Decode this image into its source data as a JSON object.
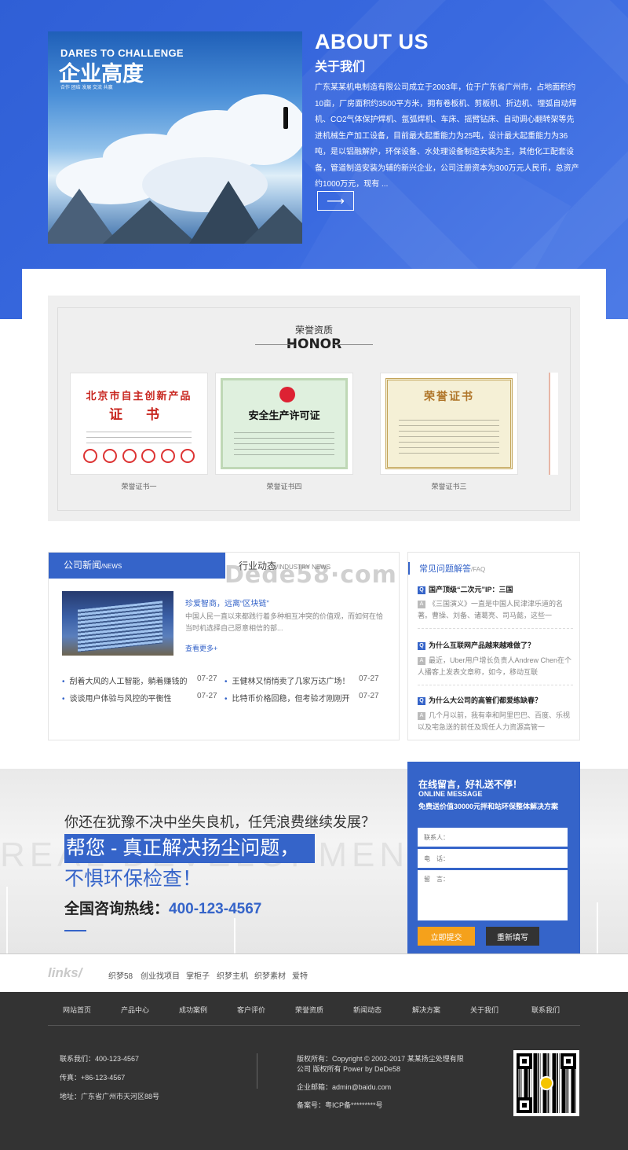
{
  "about": {
    "image_tagline": "DARES TO CHALLENGE",
    "image_title": "企业高度",
    "image_small": "合作 团结 发展 交流 共赢",
    "title": "ABOUT US",
    "subtitle": "关于我们",
    "text": "广东某某机电制造有限公司成立于2003年，位于广东省广州市，占地面积约10亩，厂房面积约3500平方米，拥有卷板机、剪板机、折边机、埋弧自动焊机、CO2气体保护焊机、氩弧焊机、车床、摇臂钻床、自动调心翻转架等先进机械生产加工设备，目前最大起重能力为25吨，设计最大起重能力为36吨，是以铝融解炉，环保设备、水处理设备制造安装为主，其他化工配套设备，管道制造安装为辅的新兴企业，公司注册资本为300万元人民币，总资产约1000万元，现有 ...",
    "more_arrow": "⟶"
  },
  "honor": {
    "title_cn": "荣誉资质",
    "title_en": "HONOR",
    "certs": [
      {
        "caption": "荣誉证书一",
        "heading": "北京市自主创新产品",
        "big": "证 书"
      },
      {
        "caption": "荣誉证书四",
        "heading": "安全生产许可证"
      },
      {
        "caption": "荣誉证书三",
        "heading": "荣誉证书"
      }
    ]
  },
  "news": {
    "tab_active": "公司新闻",
    "tab_active_en": "/NEWS",
    "tab_other": "行业动态",
    "tab_other_en": "/INDUSTRY NEWS",
    "featured_title": "珍爱智商，远离“区块链”",
    "featured_summary": "中国人民一直以来都践行着多种相互冲突的价值观，而如何在恰当时机选择自己愿意相信的部...",
    "featured_more": "查看更多+",
    "list": [
      {
        "title": "刮着大风的人工智能，躺着赚钱的",
        "date": "07-27"
      },
      {
        "title": "王健林又悄悄卖了几家万达广场！",
        "date": "07-27"
      },
      {
        "title": "谈谈用户体验与风控的平衡性",
        "date": "07-27"
      },
      {
        "title": "比特币价格回稳，但考验才刚刚开",
        "date": "07-27"
      }
    ]
  },
  "faq": {
    "title": "常见问题解答",
    "title_en": "/FAQ",
    "items": [
      {
        "q": "国产顶级“二次元”IP：三国",
        "a": "《三国演义》一直是中国人民津津乐道的名著。曹操、刘备、诸葛亮、司马懿，这些一"
      },
      {
        "q": "为什么互联网产品越来越难做了？",
        "a": "最近，Uber用户增长负责人Andrew Chen在个人播客上发表文章称，如今，移动互联"
      },
      {
        "q": "为什么大公司的高管们都爱练缺春？",
        "a": "几个月以前，我有幸和阿里巴巴、百度、乐视以及宅急送的前任及现任人力资源高管一"
      }
    ],
    "q_badge": "Q",
    "a_badge": "A"
  },
  "cta": {
    "ghost_text": "REAL DEVELOPMENT",
    "line1": "你还在犹豫不决中坐失良机，任凭浪费继续发展？",
    "line2": "帮您 - 真正解决扬尘问题，",
    "line3": "不惧环保检查！",
    "hotline_label": "全国咨询热线：",
    "hotline": "400-123-4567"
  },
  "message": {
    "title": "在线留言，好礼送不停！",
    "title_en": "ONLINE MESSAGE",
    "offer": "免费送价值30000元拌和站环保整体解决方案",
    "name_placeholder": "联系人：",
    "phone_placeholder": "电　话：",
    "msg_placeholder": "留　言：",
    "submit": "立即提交",
    "reset": "重新填写"
  },
  "links": {
    "logo": "links/",
    "items": [
      "织梦58",
      "创业找项目",
      "掌柜子",
      "织梦主机",
      "织梦素材",
      "爱特"
    ]
  },
  "footer": {
    "nav": [
      "网站首页",
      "产品中心",
      "成功案例",
      "客户评价",
      "荣誉资质",
      "新闻动态",
      "解决方案",
      "关于我们",
      "联系我们"
    ],
    "contact": "联系我们：400-123-4567",
    "fax": "传真：+86-123-4567",
    "address": "地址：广东省广州市天河区88号",
    "copyright1": "版权所有：Copyright © 2002-2017 某某扬尘处理有限",
    "copyright2": "公司 版权所有 Power by DeDe58",
    "email": "企业邮箱：admin@baidu.com",
    "icp": "备案号：粤ICP备*********号"
  },
  "watermark": "Dede58·com",
  "colors": {
    "primary": "#3564c9",
    "accent": "#f5a11b",
    "footer": "#333333"
  }
}
